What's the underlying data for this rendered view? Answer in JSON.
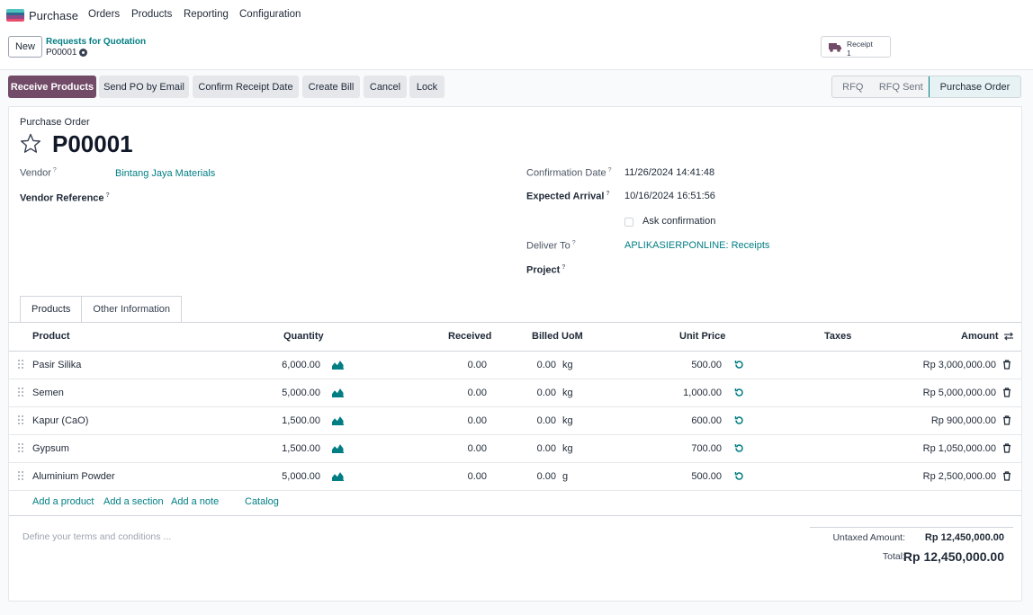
{
  "app": {
    "name": "Purchase",
    "logo_colors": [
      "#4ec3c0",
      "#2d6a8f",
      "#8e4b8a",
      "#e84c6c"
    ],
    "menu": [
      "Orders",
      "Products",
      "Reporting",
      "Configuration"
    ]
  },
  "control": {
    "new_label": "New",
    "breadcrumb_parent": "Requests for Quotation",
    "breadcrumb_current": "P00001",
    "smart_button": {
      "label": "Receipt",
      "count": "1",
      "icon": "truck-icon"
    }
  },
  "actions": [
    "Receive Products",
    "Send PO by Email",
    "Confirm Receipt Date",
    "Create Bill",
    "Cancel",
    "Lock"
  ],
  "status_stages": [
    "RFQ",
    "RFQ Sent",
    "Purchase Order"
  ],
  "active_stage": "Purchase Order",
  "form": {
    "doc_type": "Purchase Order",
    "name": "P00001",
    "vendor_label": "Vendor",
    "vendor": "Bintang Jaya Materials",
    "vendor_ref_label": "Vendor Reference",
    "confirmation_date_label": "Confirmation Date",
    "confirmation_date": "11/26/2024 14:41:48",
    "expected_arrival_label": "Expected Arrival",
    "expected_arrival": "10/16/2024 16:51:56",
    "ask_confirmation_label": "Ask confirmation",
    "deliver_to_label": "Deliver To",
    "deliver_to": "APLIKASIERPONLINE: Receipts",
    "project_label": "Project",
    "help_mark": "?"
  },
  "tabs": [
    "Products",
    "Other Information"
  ],
  "table": {
    "columns": {
      "product": "Product",
      "quantity": "Quantity",
      "received": "Received",
      "billed": "Billed",
      "uom": "UoM",
      "unit_price": "Unit Price",
      "taxes": "Taxes",
      "amount": "Amount"
    },
    "rows": [
      {
        "product": "Pasir Silika",
        "quantity": "6,000.00",
        "received": "0.00",
        "billed": "0.00",
        "uom": "kg",
        "unit_price": "500.00",
        "amount": "Rp 3,000,000.00"
      },
      {
        "product": "Semen",
        "quantity": "5,000.00",
        "received": "0.00",
        "billed": "0.00",
        "uom": "kg",
        "unit_price": "1,000.00",
        "amount": "Rp 5,000,000.00"
      },
      {
        "product": "Kapur (CaO)",
        "quantity": "1,500.00",
        "received": "0.00",
        "billed": "0.00",
        "uom": "kg",
        "unit_price": "600.00",
        "amount": "Rp 900,000.00"
      },
      {
        "product": "Gypsum",
        "quantity": "1,500.00",
        "received": "0.00",
        "billed": "0.00",
        "uom": "kg",
        "unit_price": "700.00",
        "amount": "Rp 1,050,000.00"
      },
      {
        "product": "Aluminium Powder",
        "quantity": "5,000.00",
        "received": "0.00",
        "billed": "0.00",
        "uom": "g",
        "unit_price": "500.00",
        "amount": "Rp 2,500,000.00"
      }
    ],
    "add_links": [
      "Add a product",
      "Add a section",
      "Add a note",
      "Catalog"
    ]
  },
  "terms_placeholder": "Define your terms and conditions ...",
  "totals": {
    "untaxed_label": "Untaxed Amount:",
    "untaxed": "Rp 12,450,000.00",
    "total_label": "Total:",
    "total": "Rp 12,450,000.00"
  },
  "colors": {
    "primary": "#714b67",
    "link": "#017e84"
  }
}
